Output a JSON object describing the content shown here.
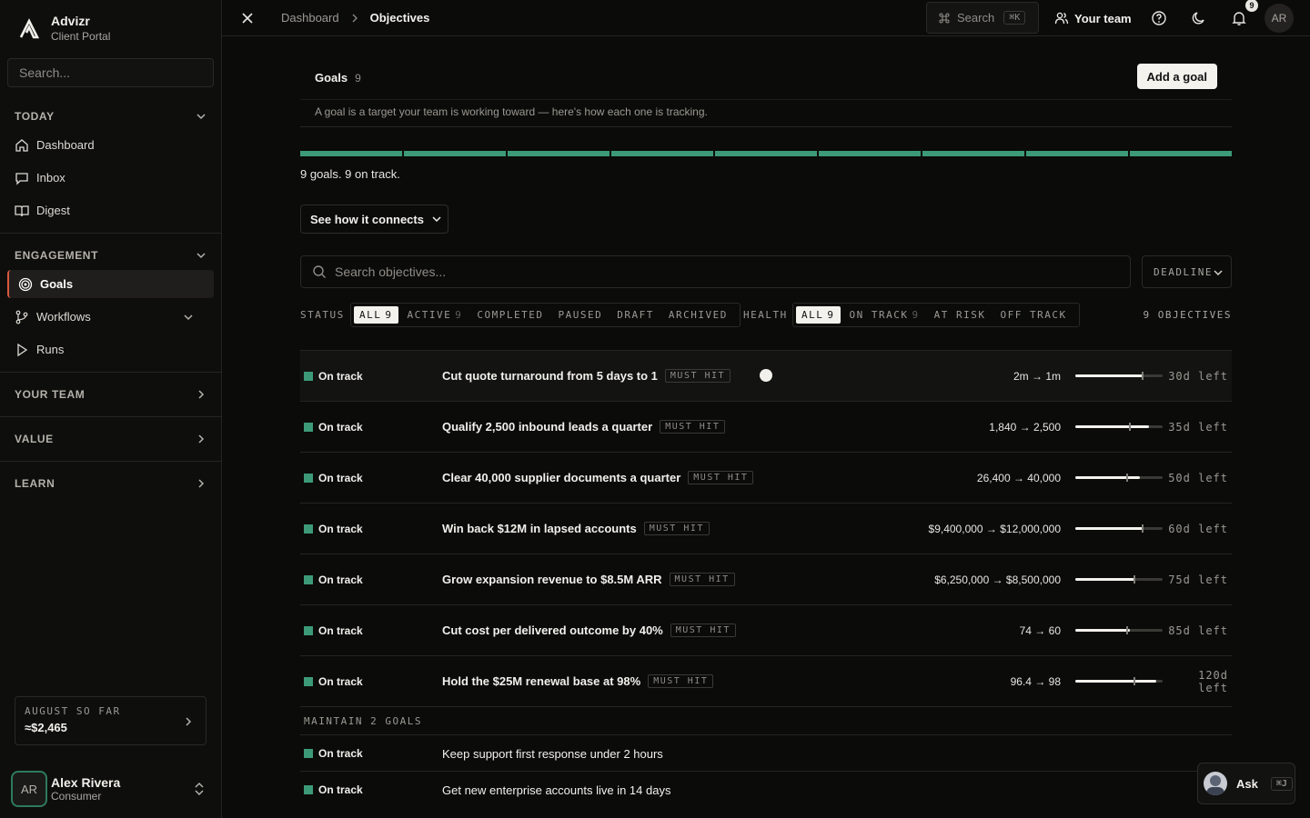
{
  "brand": {
    "name": "Advizr",
    "subtitle": "Client Portal"
  },
  "sidebar": {
    "search_placeholder": "Search...",
    "sections": {
      "today": "TODAY",
      "engagement": "ENGAGEMENT",
      "your_team": "YOUR TEAM",
      "value": "VALUE",
      "learn": "LEARN"
    },
    "items": {
      "dashboard": "Dashboard",
      "inbox": "Inbox",
      "digest": "Digest",
      "goals": "Goals",
      "workflows": "Workflows",
      "runs": "Runs"
    },
    "spend": {
      "label": "AUGUST SO FAR",
      "value": "≈$2,465"
    },
    "user": {
      "initials": "AR",
      "name": "Alex Rivera",
      "role": "Consumer"
    }
  },
  "topbar": {
    "breadcrumb": [
      "Dashboard",
      "Objectives"
    ],
    "search_label": "Search",
    "search_kbd": "⌘K",
    "your_team": "Your team",
    "notif_count": "9",
    "avatar_initials": "AR"
  },
  "goals": {
    "title": "Goals",
    "count": "9",
    "add_button": "Add a goal",
    "description": "A goal is a target your team is working toward — here's how each one is tracking.",
    "progress": {
      "total": 9,
      "on_track": 9
    },
    "summary": "9 goals. 9 on track.",
    "connects_button": "See how it connects",
    "search_placeholder": "Search objectives...",
    "sort_label": "DEADLINE"
  },
  "filters": {
    "status_label": "STATUS",
    "status_chips": [
      {
        "label": "ALL",
        "count": "9"
      },
      {
        "label": "ACTIVE",
        "count": "9"
      },
      {
        "label": "COMPLETED",
        "count": ""
      },
      {
        "label": "PAUSED",
        "count": ""
      },
      {
        "label": "DRAFT",
        "count": ""
      },
      {
        "label": "ARCHIVED",
        "count": ""
      }
    ],
    "health_label": "HEALTH",
    "health_chips": [
      {
        "label": "ALL",
        "count": "9"
      },
      {
        "label": "ON TRACK",
        "count": "9"
      },
      {
        "label": "AT RISK",
        "count": ""
      },
      {
        "label": "OFF TRACK",
        "count": ""
      }
    ],
    "objective_count": "9 OBJECTIVES"
  },
  "objectives": [
    {
      "status": "On track",
      "name": "Cut quote turnaround from 5 days to 1",
      "tag": "MUST HIT",
      "metric": "2m → 1m",
      "progress": 0.78,
      "marker": 0.76,
      "deadline": "30d left"
    },
    {
      "status": "On track",
      "name": "Qualify 2,500 inbound leads a quarter",
      "tag": "MUST HIT",
      "metric": "1,840 → 2,500",
      "progress": 0.84,
      "marker": 0.61,
      "deadline": "35d left"
    },
    {
      "status": "On track",
      "name": "Clear 40,000 supplier documents a quarter",
      "tag": "MUST HIT",
      "metric": "26,400 → 40,000",
      "progress": 0.74,
      "marker": 0.58,
      "deadline": "50d left"
    },
    {
      "status": "On track",
      "name": "Win back $12M in lapsed accounts",
      "tag": "MUST HIT",
      "metric": "$9,400,000 → $12,000,000",
      "progress": 0.78,
      "marker": 0.76,
      "deadline": "60d left"
    },
    {
      "status": "On track",
      "name": "Grow expansion revenue to $8.5M ARR",
      "tag": "MUST HIT",
      "metric": "$6,250,000 → $8,500,000",
      "progress": 0.69,
      "marker": 0.67,
      "deadline": "75d left"
    },
    {
      "status": "On track",
      "name": "Cut cost per delivered outcome by 40%",
      "tag": "MUST HIT",
      "metric": "74 → 60",
      "progress": 0.63,
      "marker": 0.58,
      "deadline": "85d left"
    },
    {
      "status": "On track",
      "name": "Hold the $25M renewal base at 98%",
      "tag": "MUST HIT",
      "metric": "96.4 → 98",
      "progress": 0.93,
      "marker": 0.67,
      "deadline_line1": "120d",
      "deadline_line2": "left"
    }
  ],
  "maintain": {
    "label": "MAINTAIN 2 GOALS",
    "items": [
      {
        "status": "On track",
        "name": "Keep support first response under 2 hours"
      },
      {
        "status": "On track",
        "name": "Get new enterprise accounts live in 14 days"
      }
    ]
  },
  "ask": {
    "label": "Ask",
    "kbd": "⌘J"
  },
  "colors": {
    "accent_green": "#3c9a78",
    "active_marker": "#d9593d",
    "background": "#0b0b0a"
  }
}
